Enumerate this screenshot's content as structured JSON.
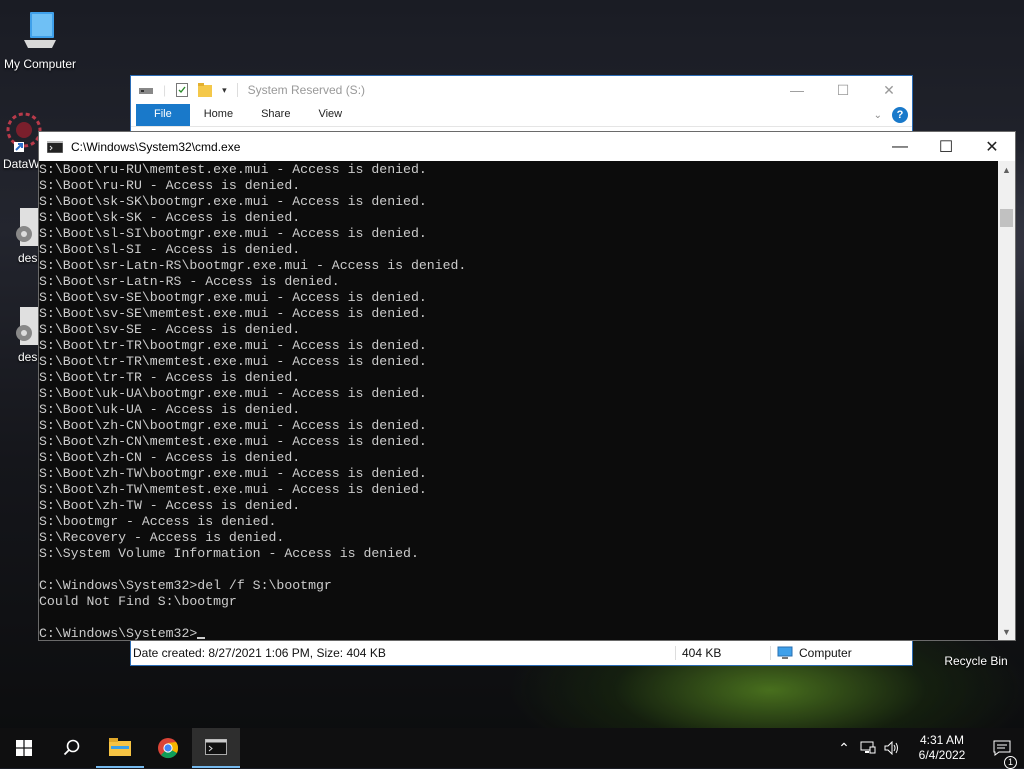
{
  "desktop": {
    "icons": [
      {
        "label": "My Computer"
      },
      {
        "label": "DataW"
      },
      {
        "label": "desl"
      },
      {
        "label": "desl"
      },
      {
        "label": "Recycle Bin"
      }
    ]
  },
  "explorer": {
    "title": "System Reserved (S:)",
    "tabs": {
      "file": "File",
      "home": "Home",
      "share": "Share",
      "view": "View"
    },
    "status": {
      "info": "Date created: 8/27/2021 1:06 PM, Size: 404 KB",
      "size": "404 KB",
      "location": "Computer"
    }
  },
  "cmd": {
    "title": "C:\\Windows\\System32\\cmd.exe",
    "lines": [
      "S:\\Boot\\ru-RU\\memtest.exe.mui - Access is denied.",
      "S:\\Boot\\ru-RU - Access is denied.",
      "S:\\Boot\\sk-SK\\bootmgr.exe.mui - Access is denied.",
      "S:\\Boot\\sk-SK - Access is denied.",
      "S:\\Boot\\sl-SI\\bootmgr.exe.mui - Access is denied.",
      "S:\\Boot\\sl-SI - Access is denied.",
      "S:\\Boot\\sr-Latn-RS\\bootmgr.exe.mui - Access is denied.",
      "S:\\Boot\\sr-Latn-RS - Access is denied.",
      "S:\\Boot\\sv-SE\\bootmgr.exe.mui - Access is denied.",
      "S:\\Boot\\sv-SE\\memtest.exe.mui - Access is denied.",
      "S:\\Boot\\sv-SE - Access is denied.",
      "S:\\Boot\\tr-TR\\bootmgr.exe.mui - Access is denied.",
      "S:\\Boot\\tr-TR\\memtest.exe.mui - Access is denied.",
      "S:\\Boot\\tr-TR - Access is denied.",
      "S:\\Boot\\uk-UA\\bootmgr.exe.mui - Access is denied.",
      "S:\\Boot\\uk-UA - Access is denied.",
      "S:\\Boot\\zh-CN\\bootmgr.exe.mui - Access is denied.",
      "S:\\Boot\\zh-CN\\memtest.exe.mui - Access is denied.",
      "S:\\Boot\\zh-CN - Access is denied.",
      "S:\\Boot\\zh-TW\\bootmgr.exe.mui - Access is denied.",
      "S:\\Boot\\zh-TW\\memtest.exe.mui - Access is denied.",
      "S:\\Boot\\zh-TW - Access is denied.",
      "S:\\bootmgr - Access is denied.",
      "S:\\Recovery - Access is denied.",
      "S:\\System Volume Information - Access is denied.",
      "",
      "C:\\Windows\\System32>del /f S:\\bootmgr",
      "Could Not Find S:\\bootmgr",
      ""
    ],
    "prompt": "C:\\Windows\\System32>"
  },
  "taskbar": {
    "time": "4:31 AM",
    "date": "6/4/2022",
    "notification_count": "1"
  },
  "icons": [
    "windows-start-icon",
    "search-icon",
    "file-explorer-icon",
    "chrome-icon",
    "cmd-icon",
    "chevron-up-icon",
    "network-icon",
    "volume-icon",
    "notification-icon"
  ]
}
